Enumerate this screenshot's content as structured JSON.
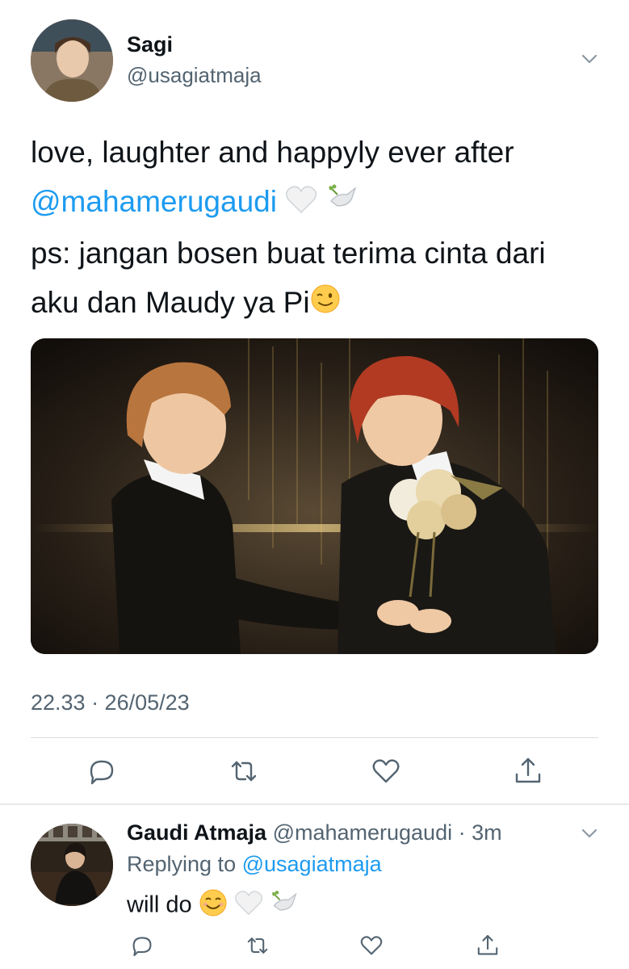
{
  "main_tweet": {
    "display_name": "Sagi",
    "handle": "@usagiatmaja",
    "line1": "love, laughter and happyly ever after",
    "mention": "@mahamerugaudi",
    "line3": "ps: jangan bosen buat terima cinta dari",
    "line4": "aku dan Maudy ya Pi",
    "timestamp": "22.33 · 26/05/23"
  },
  "actions": [
    "reply-icon",
    "retweet-icon",
    "like-icon",
    "share-icon"
  ],
  "reply": {
    "display_name": "Gaudi Atmaja",
    "handle_time": "@mahamerugaudi · 3m",
    "replying_prefix": "Replying to",
    "replying_to": "@usagiatmaja",
    "text": "will do"
  },
  "colors": {
    "accent": "#1d9bf0",
    "secondary_text": "#536471",
    "primary_text": "#0f1419"
  }
}
